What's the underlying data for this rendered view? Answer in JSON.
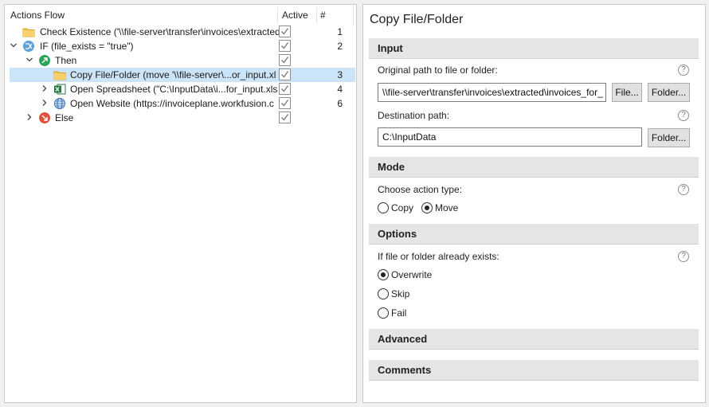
{
  "actions_flow": {
    "header": {
      "name": "Actions Flow",
      "active": "Active",
      "num": "#"
    },
    "rows": [
      {
        "label": "Check Existence ('\\\\file-server\\transfer\\invoices\\extracted",
        "num": "1"
      },
      {
        "label": "IF (file_exists = \"true\")",
        "num": "2"
      },
      {
        "label": "Then",
        "num": ""
      },
      {
        "label": "Copy File/Folder (move '\\\\file-server\\...or_input.xl",
        "num": "3"
      },
      {
        "label": "Open Spreadsheet (\"C:\\InputData\\i...for_input.xls",
        "num": "4"
      },
      {
        "label": "Open Website (https://invoiceplane.workfusion.c",
        "num": "6"
      },
      {
        "label": "Else",
        "num": ""
      }
    ]
  },
  "props": {
    "title": "Copy File/Folder",
    "input": {
      "header": "Input",
      "orig_label": "Original path to file or folder:",
      "orig_value": "\\\\file-server\\transfer\\invoices\\extracted\\invoices_for_",
      "file_btn": "File...",
      "folder_btn": "Folder...",
      "dest_label": "Destination path:",
      "dest_value": "C:\\InputData",
      "dest_folder_btn": "Folder..."
    },
    "mode": {
      "header": "Mode",
      "label": "Choose action type:",
      "copy": "Copy",
      "move": "Move",
      "selected": "Move"
    },
    "options": {
      "header": "Options",
      "label": "If file or folder already exists:",
      "overwrite": "Overwrite",
      "skip": "Skip",
      "fail": "Fail",
      "selected": "Overwrite"
    },
    "advanced": {
      "header": "Advanced"
    },
    "comments": {
      "header": "Comments"
    },
    "help_glyph": "?"
  },
  "colors": {
    "selection": "#cce4f7",
    "section": "#e5e5e5"
  }
}
